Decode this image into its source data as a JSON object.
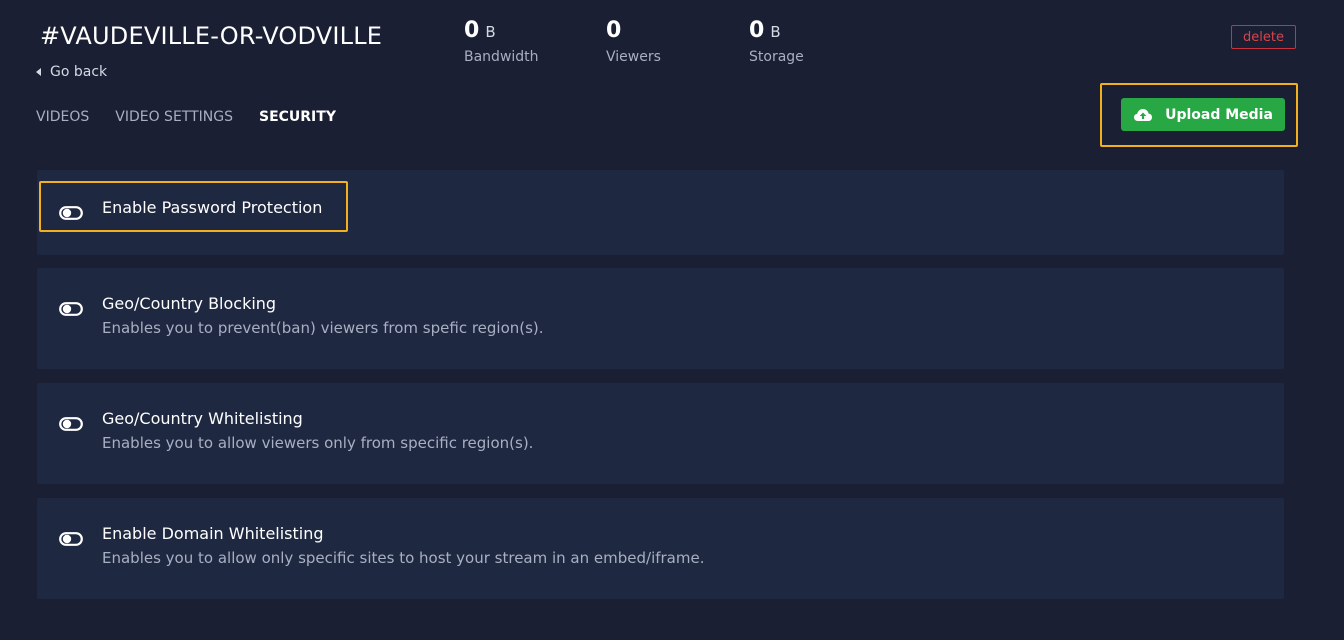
{
  "header": {
    "title": "#VAUDEVILLE-OR-VODVILLE",
    "go_back": "Go back",
    "delete_label": "delete"
  },
  "stats": {
    "bandwidth": {
      "value": "0",
      "unit": "B",
      "label": "Bandwidth"
    },
    "viewers": {
      "value": "0",
      "label": "Viewers"
    },
    "storage": {
      "value": "0",
      "unit": "B",
      "label": "Storage"
    }
  },
  "tabs": [
    {
      "label": "VIDEOS",
      "active": false
    },
    {
      "label": "VIDEO SETTINGS",
      "active": false
    },
    {
      "label": "SECURITY",
      "active": true
    }
  ],
  "upload": {
    "label": "Upload Media",
    "icon": "cloud-upload-icon"
  },
  "security_options": [
    {
      "title": "Enable Password Protection",
      "description": "",
      "enabled": false
    },
    {
      "title": "Geo/Country Blocking",
      "description": "Enables you to prevent(ban) viewers from spefic region(s).",
      "enabled": false
    },
    {
      "title": "Geo/Country Whitelisting",
      "description": "Enables you to allow viewers only from specific region(s).",
      "enabled": false
    },
    {
      "title": "Enable Domain Whitelisting",
      "description": "Enables you to allow only specific sites to host your stream in an embed/iframe.",
      "enabled": false
    }
  ],
  "colors": {
    "background": "#1a1f33",
    "card": "#1f2841",
    "accent_green": "#28a745",
    "highlight": "#f2b01e",
    "danger": "#c8323a"
  }
}
